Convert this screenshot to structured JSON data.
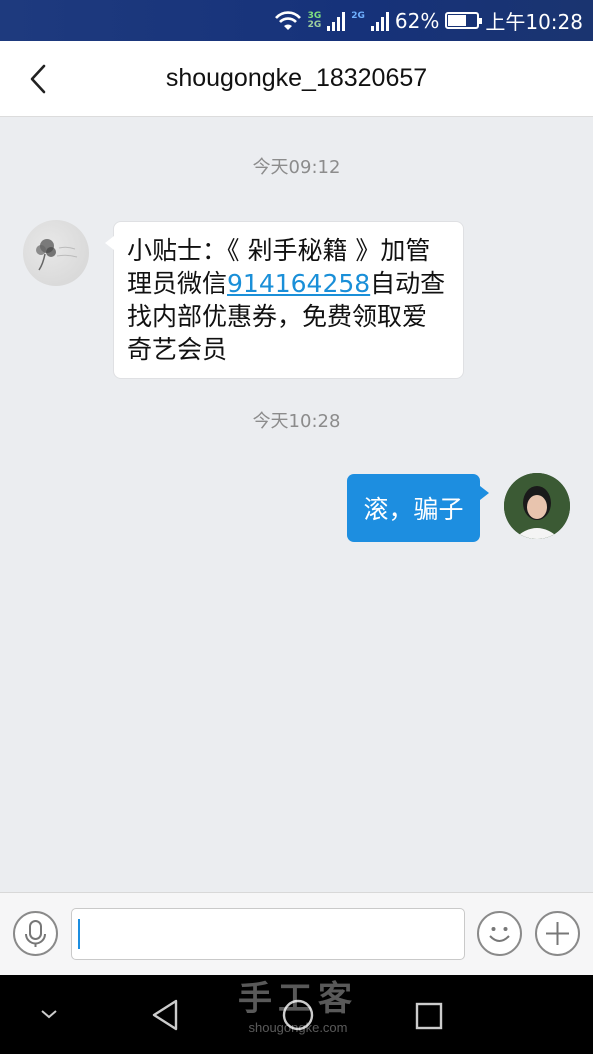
{
  "status_bar": {
    "net_top": "3G",
    "net_bottom": "2G",
    "net_second": "2G",
    "battery": "62%",
    "battery_level": 0.62,
    "time": "上午10:28"
  },
  "header": {
    "title": "shougongke_18320657"
  },
  "messages": [
    {
      "timestamp": "今天09:12",
      "direction": "incoming",
      "text_before": "小贴士：《 剁手秘籍 》加管理员微信",
      "link": "914164258",
      "text_after": "自动查找内部优惠券，免费领取爱奇艺会员"
    },
    {
      "timestamp": "今天10:28",
      "direction": "outgoing",
      "text": "滚，骗子"
    }
  ],
  "input": {
    "value": "",
    "placeholder": ""
  },
  "watermark": {
    "big": "手工客",
    "small": "shougongke.com"
  },
  "colors": {
    "accent": "#1d8ee0",
    "link": "#1a8fd8",
    "chat_bg": "#ebedf0"
  }
}
